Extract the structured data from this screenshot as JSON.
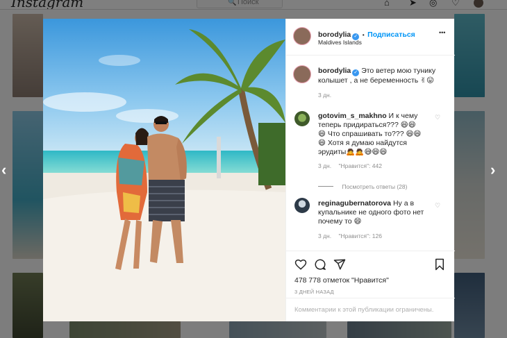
{
  "app": {
    "logo": "Instagram"
  },
  "search": {
    "placeholder": "Поиск"
  },
  "post": {
    "author": "borodylia",
    "follow_label": "Подписаться",
    "location": "Maldives Islands",
    "more_label": "•••",
    "caption": "Это ветер мою тунику колышет , а не беременность",
    "caption_emoji": "✌😛",
    "caption_age": "3 дн.",
    "comments": [
      {
        "author": "gotovim_s_makhno",
        "lines": [
          "И к чему",
          "теперь придираться??? 😄😄",
          "😄 Что спрашивать то??? 😄😄",
          "😄 Хотя я думаю найдутся",
          "эрудиты🙇🙇😅😄😄"
        ],
        "age": "3 дн.",
        "likes": "\"Нравится\": 442"
      },
      {
        "author": "reginagubernatorova",
        "lines": [
          "Ну а в",
          "купальнике не одного фото нет",
          "почему то 😄"
        ],
        "age": "3 дн.",
        "likes": "\"Нравится\": 126"
      }
    ],
    "view_replies": "Посмотреть ответы (28)",
    "likes_count": "478 778 отметок \"Нравится\"",
    "date": "3 ДНЕЙ НАЗАД",
    "comments_limited": "Комментарии к этой публикации ограничены."
  },
  "icons": {
    "heart": "heart-icon",
    "comment": "comment-icon",
    "share": "share-icon",
    "save": "bookmark-icon"
  }
}
